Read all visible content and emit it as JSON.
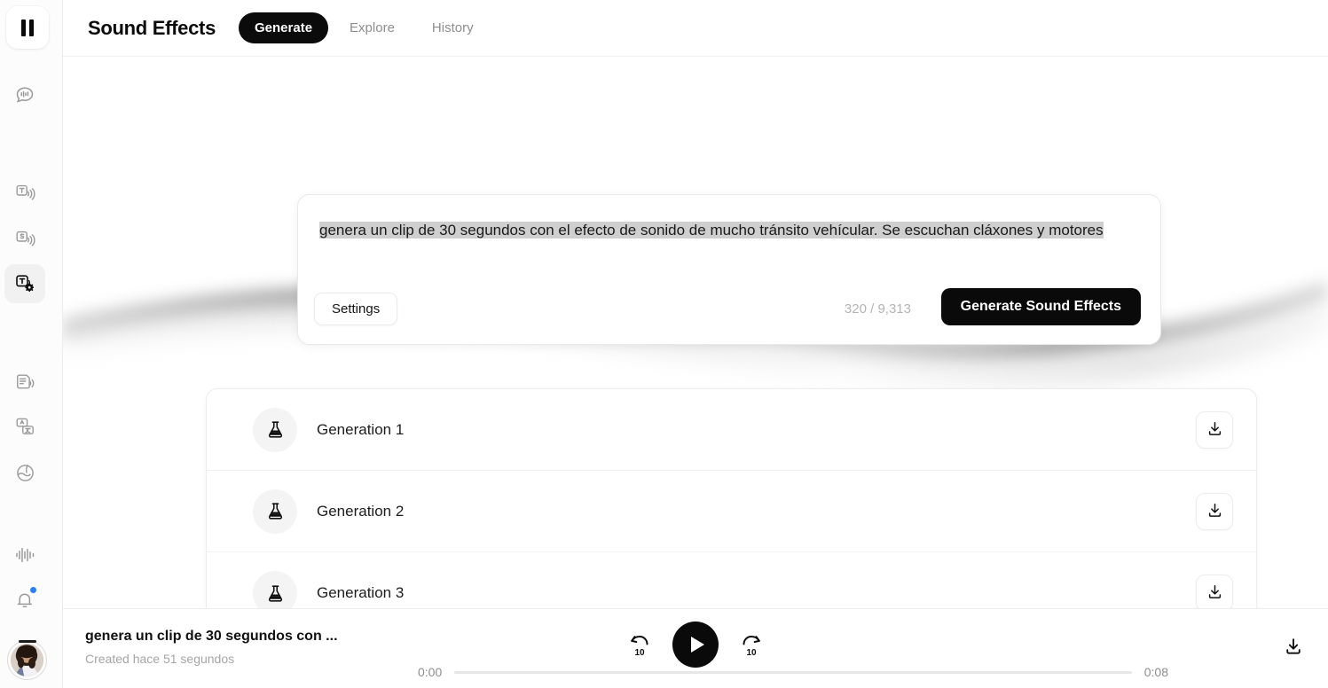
{
  "app": {
    "logo_name": "elevenlabs-logo"
  },
  "header": {
    "title": "Sound Effects",
    "tabs": [
      {
        "label": "Generate",
        "active": true
      },
      {
        "label": "Explore",
        "active": false
      },
      {
        "label": "History",
        "active": false
      }
    ]
  },
  "sidebar": {
    "items": [
      {
        "name": "sidebar-item-voice-chat",
        "icon": "speech-bubble-waveform-icon",
        "active": false
      },
      {
        "name": "sidebar-item-text-to-speech",
        "icon": "text-to-speech-icon",
        "active": false
      },
      {
        "name": "sidebar-item-speech-to-speech",
        "icon": "speech-to-speech-icon",
        "active": false
      },
      {
        "name": "sidebar-item-sound-effects",
        "icon": "sound-effects-gear-icon",
        "active": true
      },
      {
        "name": "sidebar-item-audio-native",
        "icon": "document-audio-icon",
        "active": false
      },
      {
        "name": "sidebar-item-dubbing",
        "icon": "translate-icon",
        "active": false
      },
      {
        "name": "sidebar-item-voices",
        "icon": "globe-voice-icon",
        "active": false
      },
      {
        "name": "sidebar-item-audio-tools",
        "icon": "waveform-icon",
        "active": false
      },
      {
        "name": "sidebar-item-notifications",
        "icon": "bell-icon",
        "active": false,
        "badge": true
      }
    ],
    "badge_color": "#2d7ff9",
    "avatar_name": "user-avatar"
  },
  "prompt": {
    "text_selected": "genera un clip de 30 segundos con el efecto de sonido de mucho tránsito vehícular. Se escuchan cláxones y motores",
    "settings_label": "Settings",
    "char_counter": "320 / 9,313",
    "generate_label": "Generate Sound Effects"
  },
  "generations": {
    "rows": [
      {
        "label": "Generation 1",
        "download": "download-icon"
      },
      {
        "label": "Generation 2",
        "download": "download-icon"
      },
      {
        "label": "Generation 3",
        "download": "download-icon"
      }
    ]
  },
  "player": {
    "title": "genera un clip de 30 segundos con ...",
    "subtitle": "Created hace 51 segundos",
    "rewind_label": "10",
    "forward_label": "10",
    "play_state": "paused",
    "current_time": "0:00",
    "total_time": "0:08",
    "progress_percent": 0,
    "download": "download-icon"
  },
  "colors": {
    "accent": "#0a0a0a",
    "badge": "#2d7ff9",
    "selection": "#cfcfcf",
    "muted_text": "#a5a5a5"
  }
}
